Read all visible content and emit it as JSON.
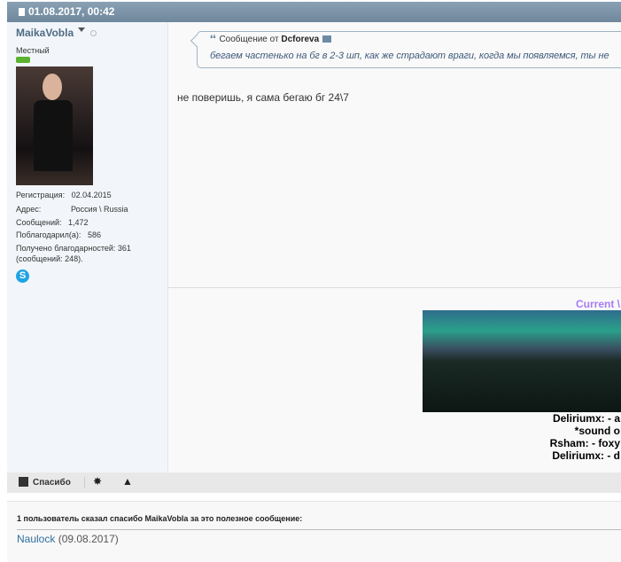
{
  "post": {
    "date": "01.08.2017, 00:42"
  },
  "user": {
    "name": "MaikaVobla",
    "rank": "Местный",
    "info": [
      {
        "label": "Регистрация:",
        "value": "02.04.2015"
      },
      {
        "label": "Адрес:",
        "value": "Россия \\ Russia"
      },
      {
        "label": "Сообщений:",
        "value": "1,472"
      },
      {
        "label": "Поблагодарил(а):",
        "value": "586"
      }
    ],
    "thanks_received": "Получено благодарностей: 361",
    "thanks_received_posts": "(сообщений: 248).",
    "skype_icon": "S"
  },
  "quote": {
    "prefix": "Сообщение от",
    "author": "Dcforeva",
    "text": "бегаем частенько на бг в 2-3 шп, как же страдают враги, когда мы появляемся, ты не"
  },
  "message": "не поверишь, я сама бегаю бг 24\\7",
  "signature": {
    "title": "Current \\",
    "lines": [
      "Deliriumx: - a",
      "*sound o",
      "Rsham: - foxy",
      "Deliriumx: - d"
    ]
  },
  "actions": {
    "thanks": "Спасибо"
  },
  "thanks_box": {
    "title": "1 пользователь сказал спасибо MaikaVobla за это полезное сообщение:",
    "user": "Naulock",
    "date": "(09.08.2017)"
  }
}
